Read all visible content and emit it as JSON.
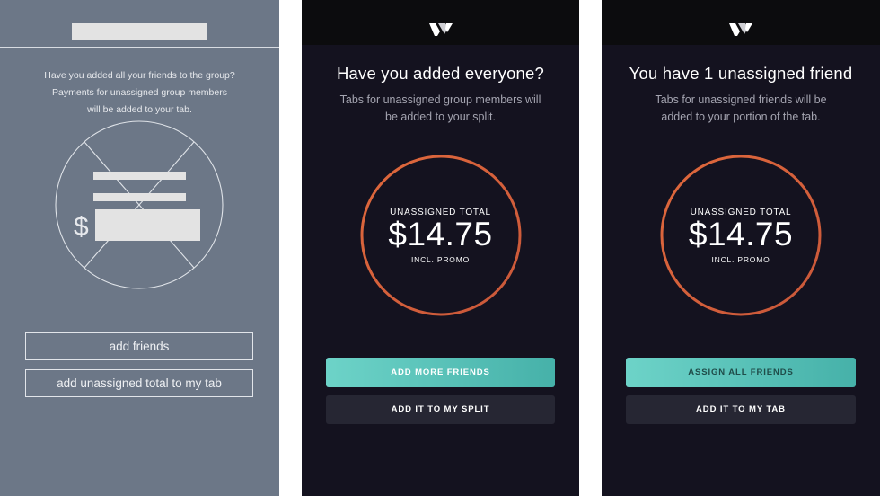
{
  "wireframe": {
    "message_lines": [
      "Have you added all your friends to the group?",
      "Payments for unassigned group members",
      "will be added to your tab."
    ],
    "currency_symbol": "$",
    "add_friends_label": "add friends",
    "add_total_label": "add unassigned total to my tab"
  },
  "screen_split": {
    "title": "Have you added everyone?",
    "subtitle_lines": [
      "Tabs for unassigned group members will",
      "be added to your split."
    ],
    "total_label": "UNASSIGNED TOTAL",
    "total_amount": "$14.75",
    "promo_label": "INCL. PROMO",
    "primary_button": "ADD MORE FRIENDS",
    "secondary_button": "ADD IT TO MY SPLIT"
  },
  "screen_tab": {
    "title": "You have 1 unassigned friend",
    "subtitle_lines": [
      "Tabs for unassigned friends will be",
      "added to your portion of the tab."
    ],
    "total_label": "UNASSIGNED TOTAL",
    "total_amount": "$14.75",
    "promo_label": "INCL. PROMO",
    "primary_button": "ASSIGN ALL FRIENDS",
    "secondary_button": "ADD IT TO MY TAB"
  },
  "icons": {
    "logo": "w-logo-icon",
    "placeholder_image": "crossed-circle-placeholder-icon"
  },
  "colors": {
    "wireframe_bg": "#6c7787",
    "app_bg": "#14121f",
    "ring": "#d9643a",
    "accent_teal": "#4fb9b0",
    "secondary_btn": "#262633"
  }
}
